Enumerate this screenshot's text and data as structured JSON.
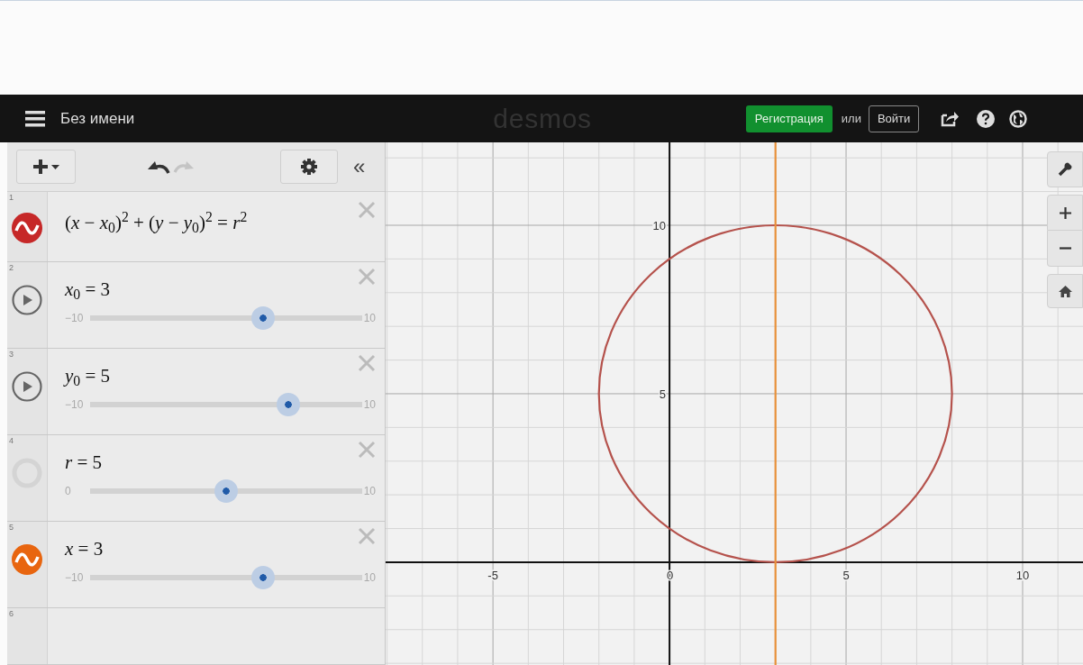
{
  "header": {
    "title": "Без имени",
    "logo": "desmos",
    "signup_button": "Регистрация",
    "or_text": "или",
    "login_button": "Войти"
  },
  "toolbar": {
    "collapse_label": "«"
  },
  "expressions": [
    {
      "number": "1",
      "kind": "equation",
      "color": "#c62828",
      "text": "(*x* − *x*$_{0}$)$^{2}$ + (*y* − *y*$_{0}$)$^{2}$ = *r*$^{2}$"
    },
    {
      "number": "2",
      "kind": "slider",
      "text": "*x*$_{0}$ = 3",
      "min": "−10",
      "max": "10",
      "level": 0.65
    },
    {
      "number": "3",
      "kind": "slider",
      "text": "*y*$_{0}$ = 5",
      "min": "−10",
      "max": "10",
      "level": 0.75
    },
    {
      "number": "4",
      "kind": "hiddenslider",
      "text": "*r* = 5",
      "min": "0",
      "max": "10",
      "level": 0.5
    },
    {
      "number": "5",
      "kind": "lineslider",
      "color": "#e8650f",
      "text": "*x* = 3",
      "min": "−10",
      "max": "10",
      "level": 0.65
    },
    {
      "number": "6",
      "kind": "empty"
    }
  ],
  "graph": {
    "chart_data": {
      "type": "line",
      "grid": true,
      "xlim": [
        -8.04,
        11.71
      ],
      "ylim": [
        -3.05,
        12.46
      ],
      "xticks": [
        -5,
        0,
        5,
        10
      ],
      "yticks": [
        5,
        10
      ],
      "series": [
        {
          "color": "#e8913a",
          "x": [
            3,
            3
          ],
          "values": [
            -3.05,
            12.46
          ]
        }
      ]
    }
  }
}
